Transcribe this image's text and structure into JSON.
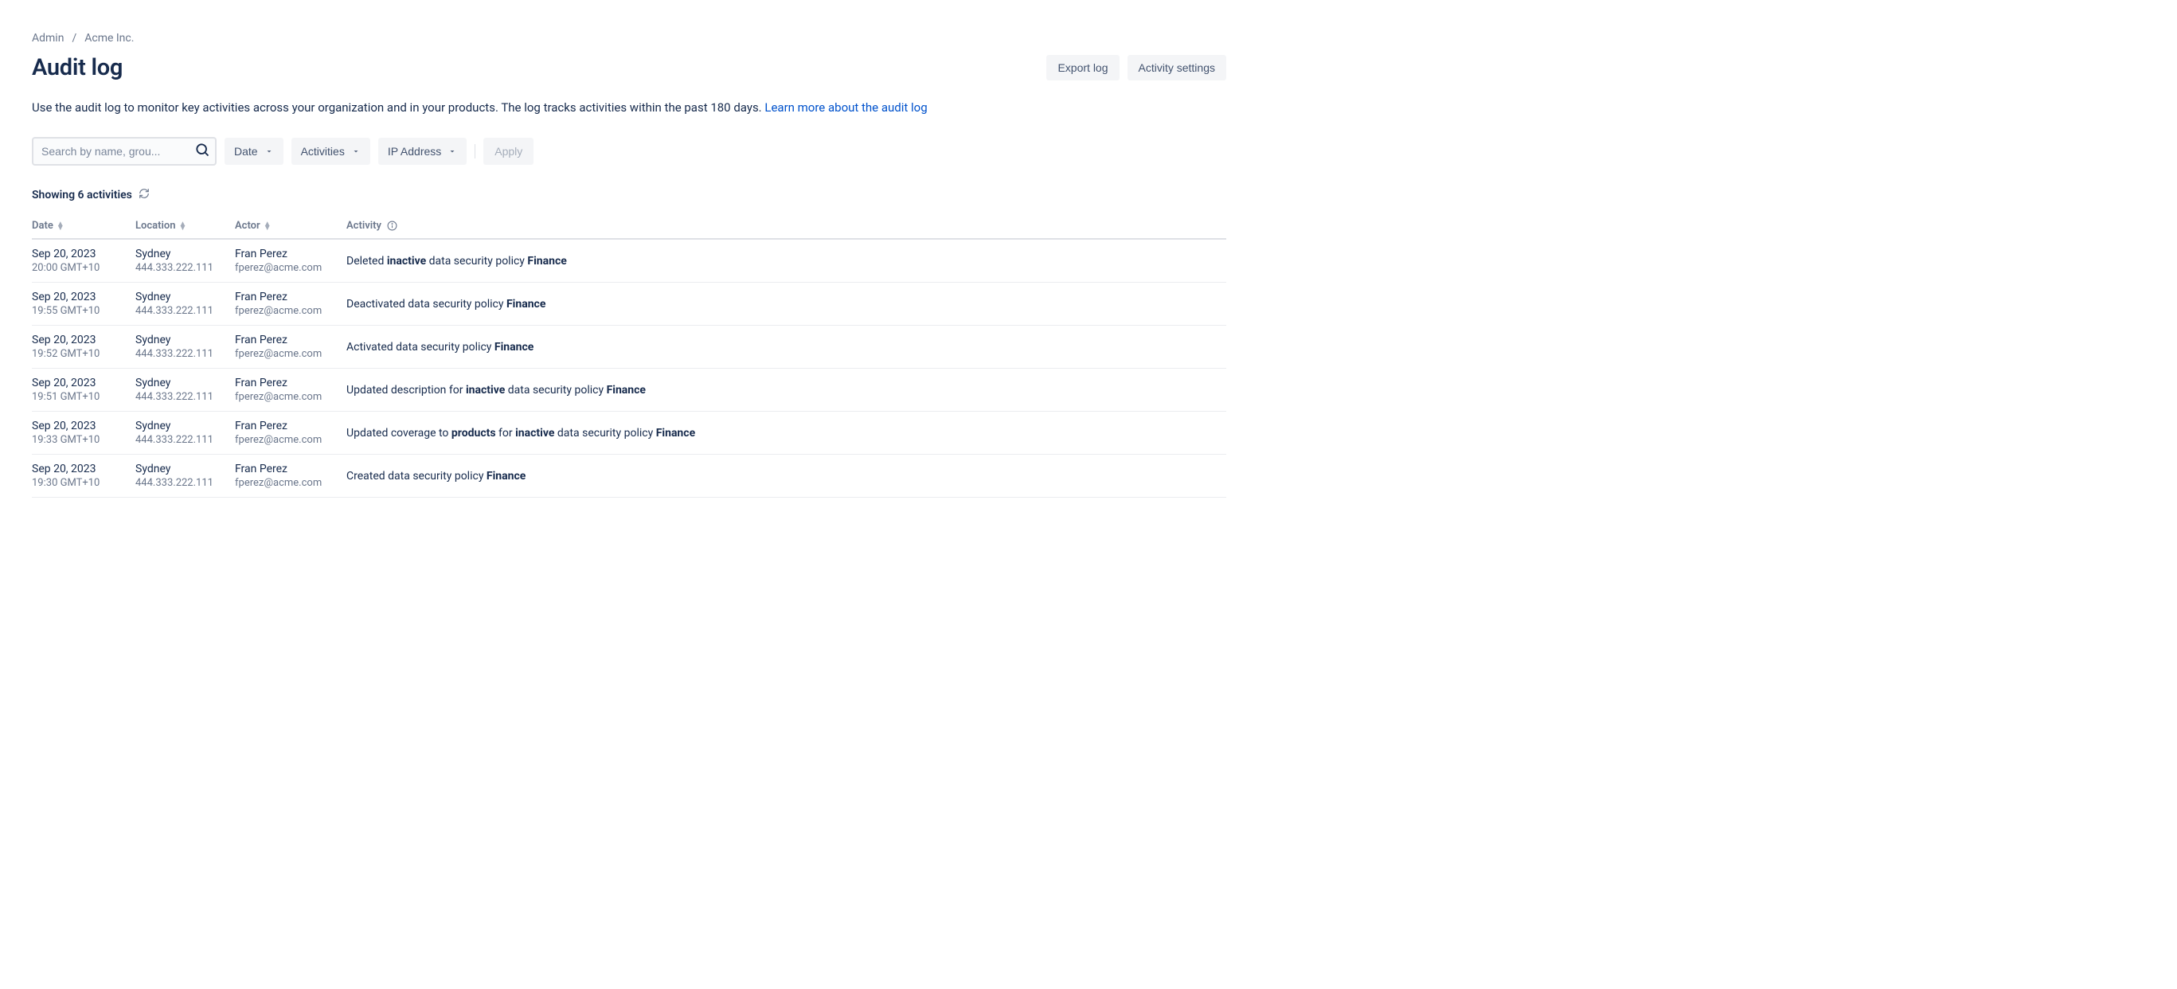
{
  "breadcrumb": {
    "admin": "Admin",
    "org": "Acme Inc."
  },
  "page_title": "Audit log",
  "buttons": {
    "export": "Export log",
    "settings": "Activity settings",
    "apply": "Apply"
  },
  "intro_text": "Use the audit log to monitor key activities across your organization and in your products. The log tracks activities within the past 180 days. ",
  "intro_link": "Learn more about the audit log",
  "search_placeholder": "Search by name, grou...",
  "filters": {
    "date": "Date",
    "activities": "Activities",
    "ip": "IP Address"
  },
  "summary": "Showing 6 activities",
  "columns": {
    "date": "Date",
    "location": "Location",
    "actor": "Actor",
    "activity": "Activity"
  },
  "rows": [
    {
      "date": "Sep 20, 2023",
      "time": "20:00 GMT+10",
      "city": "Sydney",
      "ip": "444.333.222.111",
      "actor": "Fran Perez",
      "email": "fperez@acme.com",
      "activity_html": "Deleted <b>inactive</b> data security policy <b>Finance</b>"
    },
    {
      "date": "Sep 20, 2023",
      "time": "19:55 GMT+10",
      "city": "Sydney",
      "ip": "444.333.222.111",
      "actor": "Fran Perez",
      "email": "fperez@acme.com",
      "activity_html": "Deactivated data security policy <b>Finance</b>"
    },
    {
      "date": "Sep 20, 2023",
      "time": "19:52 GMT+10",
      "city": "Sydney",
      "ip": "444.333.222.111",
      "actor": "Fran Perez",
      "email": "fperez@acme.com",
      "activity_html": "Activated data security policy <b>Finance</b>"
    },
    {
      "date": "Sep 20, 2023",
      "time": "19:51 GMT+10",
      "city": "Sydney",
      "ip": "444.333.222.111",
      "actor": "Fran Perez",
      "email": "fperez@acme.com",
      "activity_html": "Updated description for <b>inactive</b> data security policy <b>Finance</b>"
    },
    {
      "date": "Sep 20, 2023",
      "time": "19:33 GMT+10",
      "city": "Sydney",
      "ip": "444.333.222.111",
      "actor": "Fran Perez",
      "email": "fperez@acme.com",
      "activity_html": "Updated coverage to <b>products</b> for <b>inactive</b> data security policy <b>Finance</b>"
    },
    {
      "date": "Sep 20, 2023",
      "time": "19:30 GMT+10",
      "city": "Sydney",
      "ip": "444.333.222.111",
      "actor": "Fran Perez",
      "email": "fperez@acme.com",
      "activity_html": "Created data security policy <b>Finance</b>"
    }
  ]
}
